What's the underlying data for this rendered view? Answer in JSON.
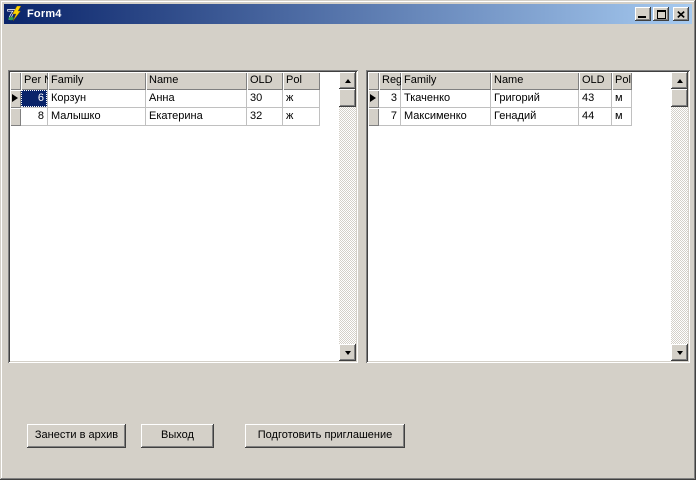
{
  "window": {
    "title": "Form4"
  },
  "colors": {
    "titlebar_gradient_start": "#0A246A",
    "titlebar_gradient_end": "#A6CAF0",
    "face": "#D4D0C8",
    "selection": "#0A246A",
    "grid_line": "#C0C0C0"
  },
  "left_grid": {
    "headers": [
      "Per N",
      "Family",
      "Name",
      "OLD",
      "Pol"
    ],
    "rows": [
      {
        "num": "6",
        "family": "Корзун",
        "name": "Анна",
        "old": "30",
        "pol": "ж"
      },
      {
        "num": "8",
        "family": "Малышко",
        "name": "Екатерина",
        "old": "32",
        "pol": "ж"
      }
    ],
    "current_row": 0,
    "selected_cell": "num"
  },
  "right_grid": {
    "headers": [
      "Reg",
      "Family",
      "Name",
      "OLD",
      "Pol"
    ],
    "rows": [
      {
        "num": "3",
        "family": "Ткаченко",
        "name": "Григорий",
        "old": "43",
        "pol": "м"
      },
      {
        "num": "7",
        "family": "Максименко",
        "name": "Генадий",
        "old": "44",
        "pol": "м"
      }
    ],
    "current_row": 0
  },
  "buttons": {
    "archive": "Занести в архив",
    "exit": "Выход",
    "invite": "Подготовить приглашение"
  }
}
